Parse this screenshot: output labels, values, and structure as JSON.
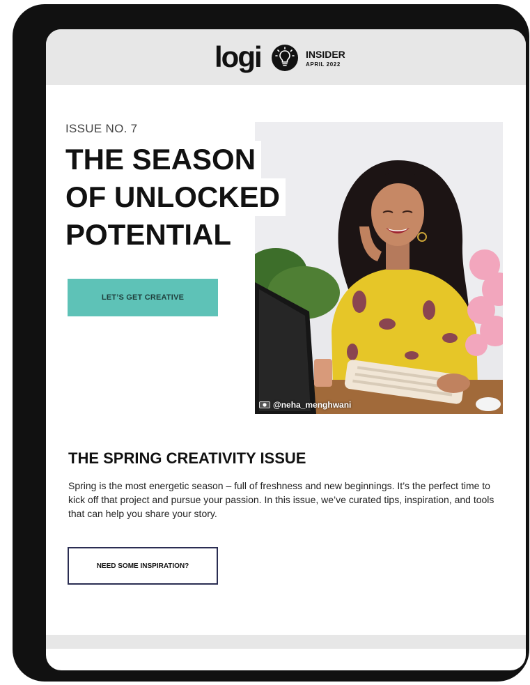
{
  "header": {
    "logo_text": "logi",
    "newsletter_title": "INSIDER",
    "newsletter_date": "APRIL 2022"
  },
  "hero": {
    "issue_label": "ISSUE NO. 7",
    "headline_lines": [
      "THE SEASON",
      "OF UNLOCKED",
      "POTENTIAL"
    ],
    "cta_label": "LET’S GET CREATIVE",
    "photo_credit": "@neha_menghwani"
  },
  "section": {
    "title": "THE SPRING CREATIVITY ISSUE",
    "body": "Spring is the most energetic season – full of freshness and new beginnings. It’s the perfect time to kick off that project and pursue your passion. In this issue, we’ve curated tips, inspiration, and tools that can help you share your story.",
    "cta_label": "NEED SOME INSPIRATION?"
  },
  "colors": {
    "accent_teal": "#5ec2b7",
    "outline_navy": "#2a2d52",
    "header_gray": "#e7e7e7",
    "device_frame": "#111111"
  },
  "icons": {
    "logo_badge": "lightbulb-icon",
    "credit": "camera-icon"
  }
}
